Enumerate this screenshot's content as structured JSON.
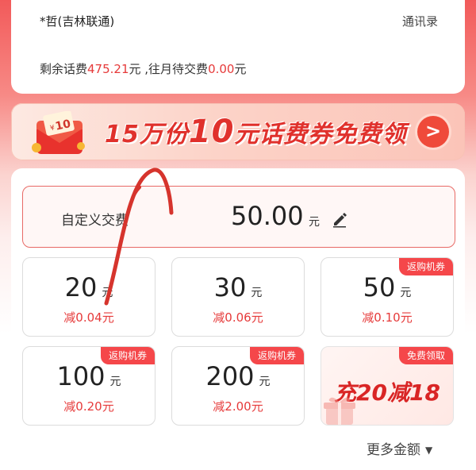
{
  "account": {
    "name": "*哲(吉林联通)",
    "contacts_label": "通讯录",
    "balance_prefix": "剩余话费",
    "balance_value": "475.21",
    "balance_unit": "元 ,往月待交费",
    "due_value": "0.00",
    "due_unit": "元"
  },
  "promo_banner": {
    "envelope_value": "10",
    "text_a": "15万份",
    "text_big": "10",
    "text_b": "元话费券免费领",
    "arrow_icon": "chevron-right-icon"
  },
  "custom_recharge": {
    "label": "自定义交费",
    "amount": "50.00",
    "unit": "元",
    "edit_icon": "pencil-icon"
  },
  "tiles": [
    {
      "amount": "20",
      "unit": "元",
      "discount": "减0.04元",
      "badge": ""
    },
    {
      "amount": "30",
      "unit": "元",
      "discount": "减0.06元",
      "badge": ""
    },
    {
      "amount": "50",
      "unit": "元",
      "discount": "减0.10元",
      "badge": "返购机券"
    },
    {
      "amount": "100",
      "unit": "元",
      "discount": "减0.20元",
      "badge": "返购机券"
    },
    {
      "amount": "200",
      "unit": "元",
      "discount": "减2.00元",
      "badge": "返购机券"
    }
  ],
  "promo_tile": {
    "badge": "免费领取",
    "text": "充20减18",
    "icon": "gift-icon"
  },
  "more": {
    "label": "更多金额",
    "icon": "caret-down-icon"
  },
  "colors": {
    "accent": "#e63a3a",
    "badge": "#f5474a",
    "annotation": "#d6342d"
  }
}
